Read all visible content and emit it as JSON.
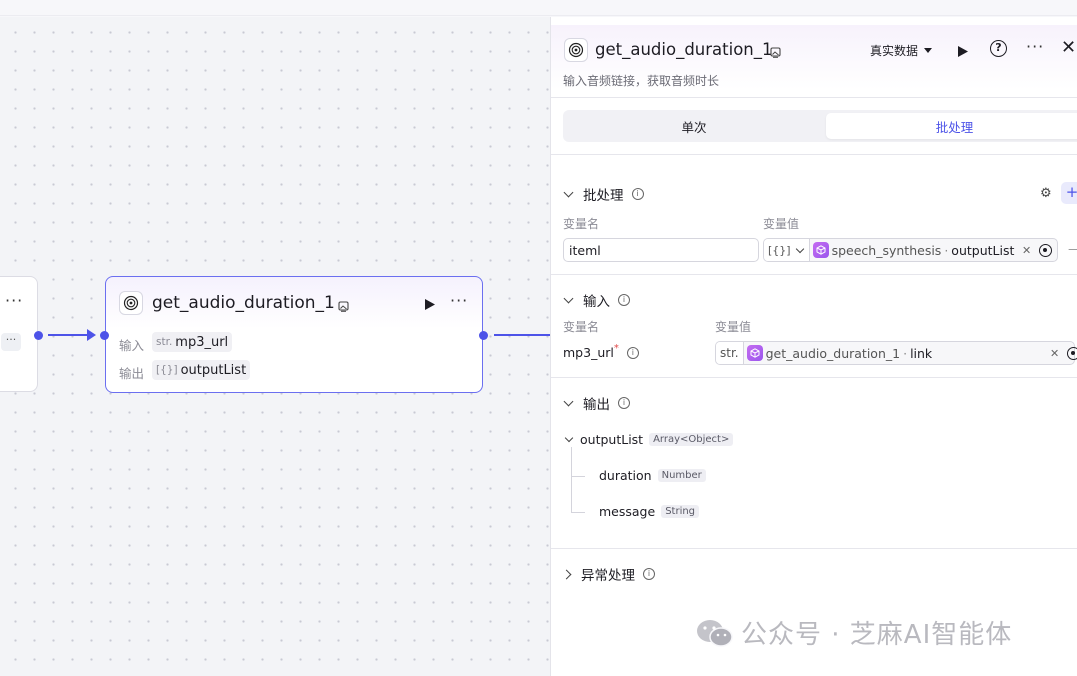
{
  "canvas": {
    "node": {
      "title": "get_audio_duration_1",
      "input_label": "输入",
      "input_type": "str.",
      "input_value": "mp3_url",
      "output_label": "输出",
      "output_type": "[{}]",
      "output_value": "outputList"
    },
    "stub_chip": "···"
  },
  "panel": {
    "title": "get_audio_duration_1",
    "description": "输入音频链接，获取音频时长",
    "data_source": "真实数据",
    "tabs": [
      {
        "label": "单次",
        "active": false
      },
      {
        "label": "批处理",
        "active": true
      }
    ],
    "batch": {
      "title": "批处理",
      "col_name": "变量名",
      "col_value": "变量值",
      "var_name": "iteml",
      "ref_type": "[{}]",
      "ref_source": "speech_synthesis",
      "ref_sep": "·",
      "ref_field": "outputList"
    },
    "input": {
      "title": "输入",
      "col_name": "变量名",
      "col_value": "变量值",
      "param_name": "mp3_url",
      "required_mark": "*",
      "ref_type": "str.",
      "ref_source": "get_audio_duration_1",
      "ref_sep": "·",
      "ref_field": "link"
    },
    "output": {
      "title": "输出",
      "root": {
        "name": "outputList",
        "type": "Array<Object>"
      },
      "children": [
        {
          "name": "duration",
          "type": "Number"
        },
        {
          "name": "message",
          "type": "String"
        }
      ]
    },
    "error_handling": {
      "title": "异常处理"
    }
  },
  "watermark": "公众号 · 芝麻AI智能体",
  "colors": {
    "accent": "#4d53e8",
    "node_border": "#6b6ff0",
    "plugin_icon": "#b164ef"
  }
}
